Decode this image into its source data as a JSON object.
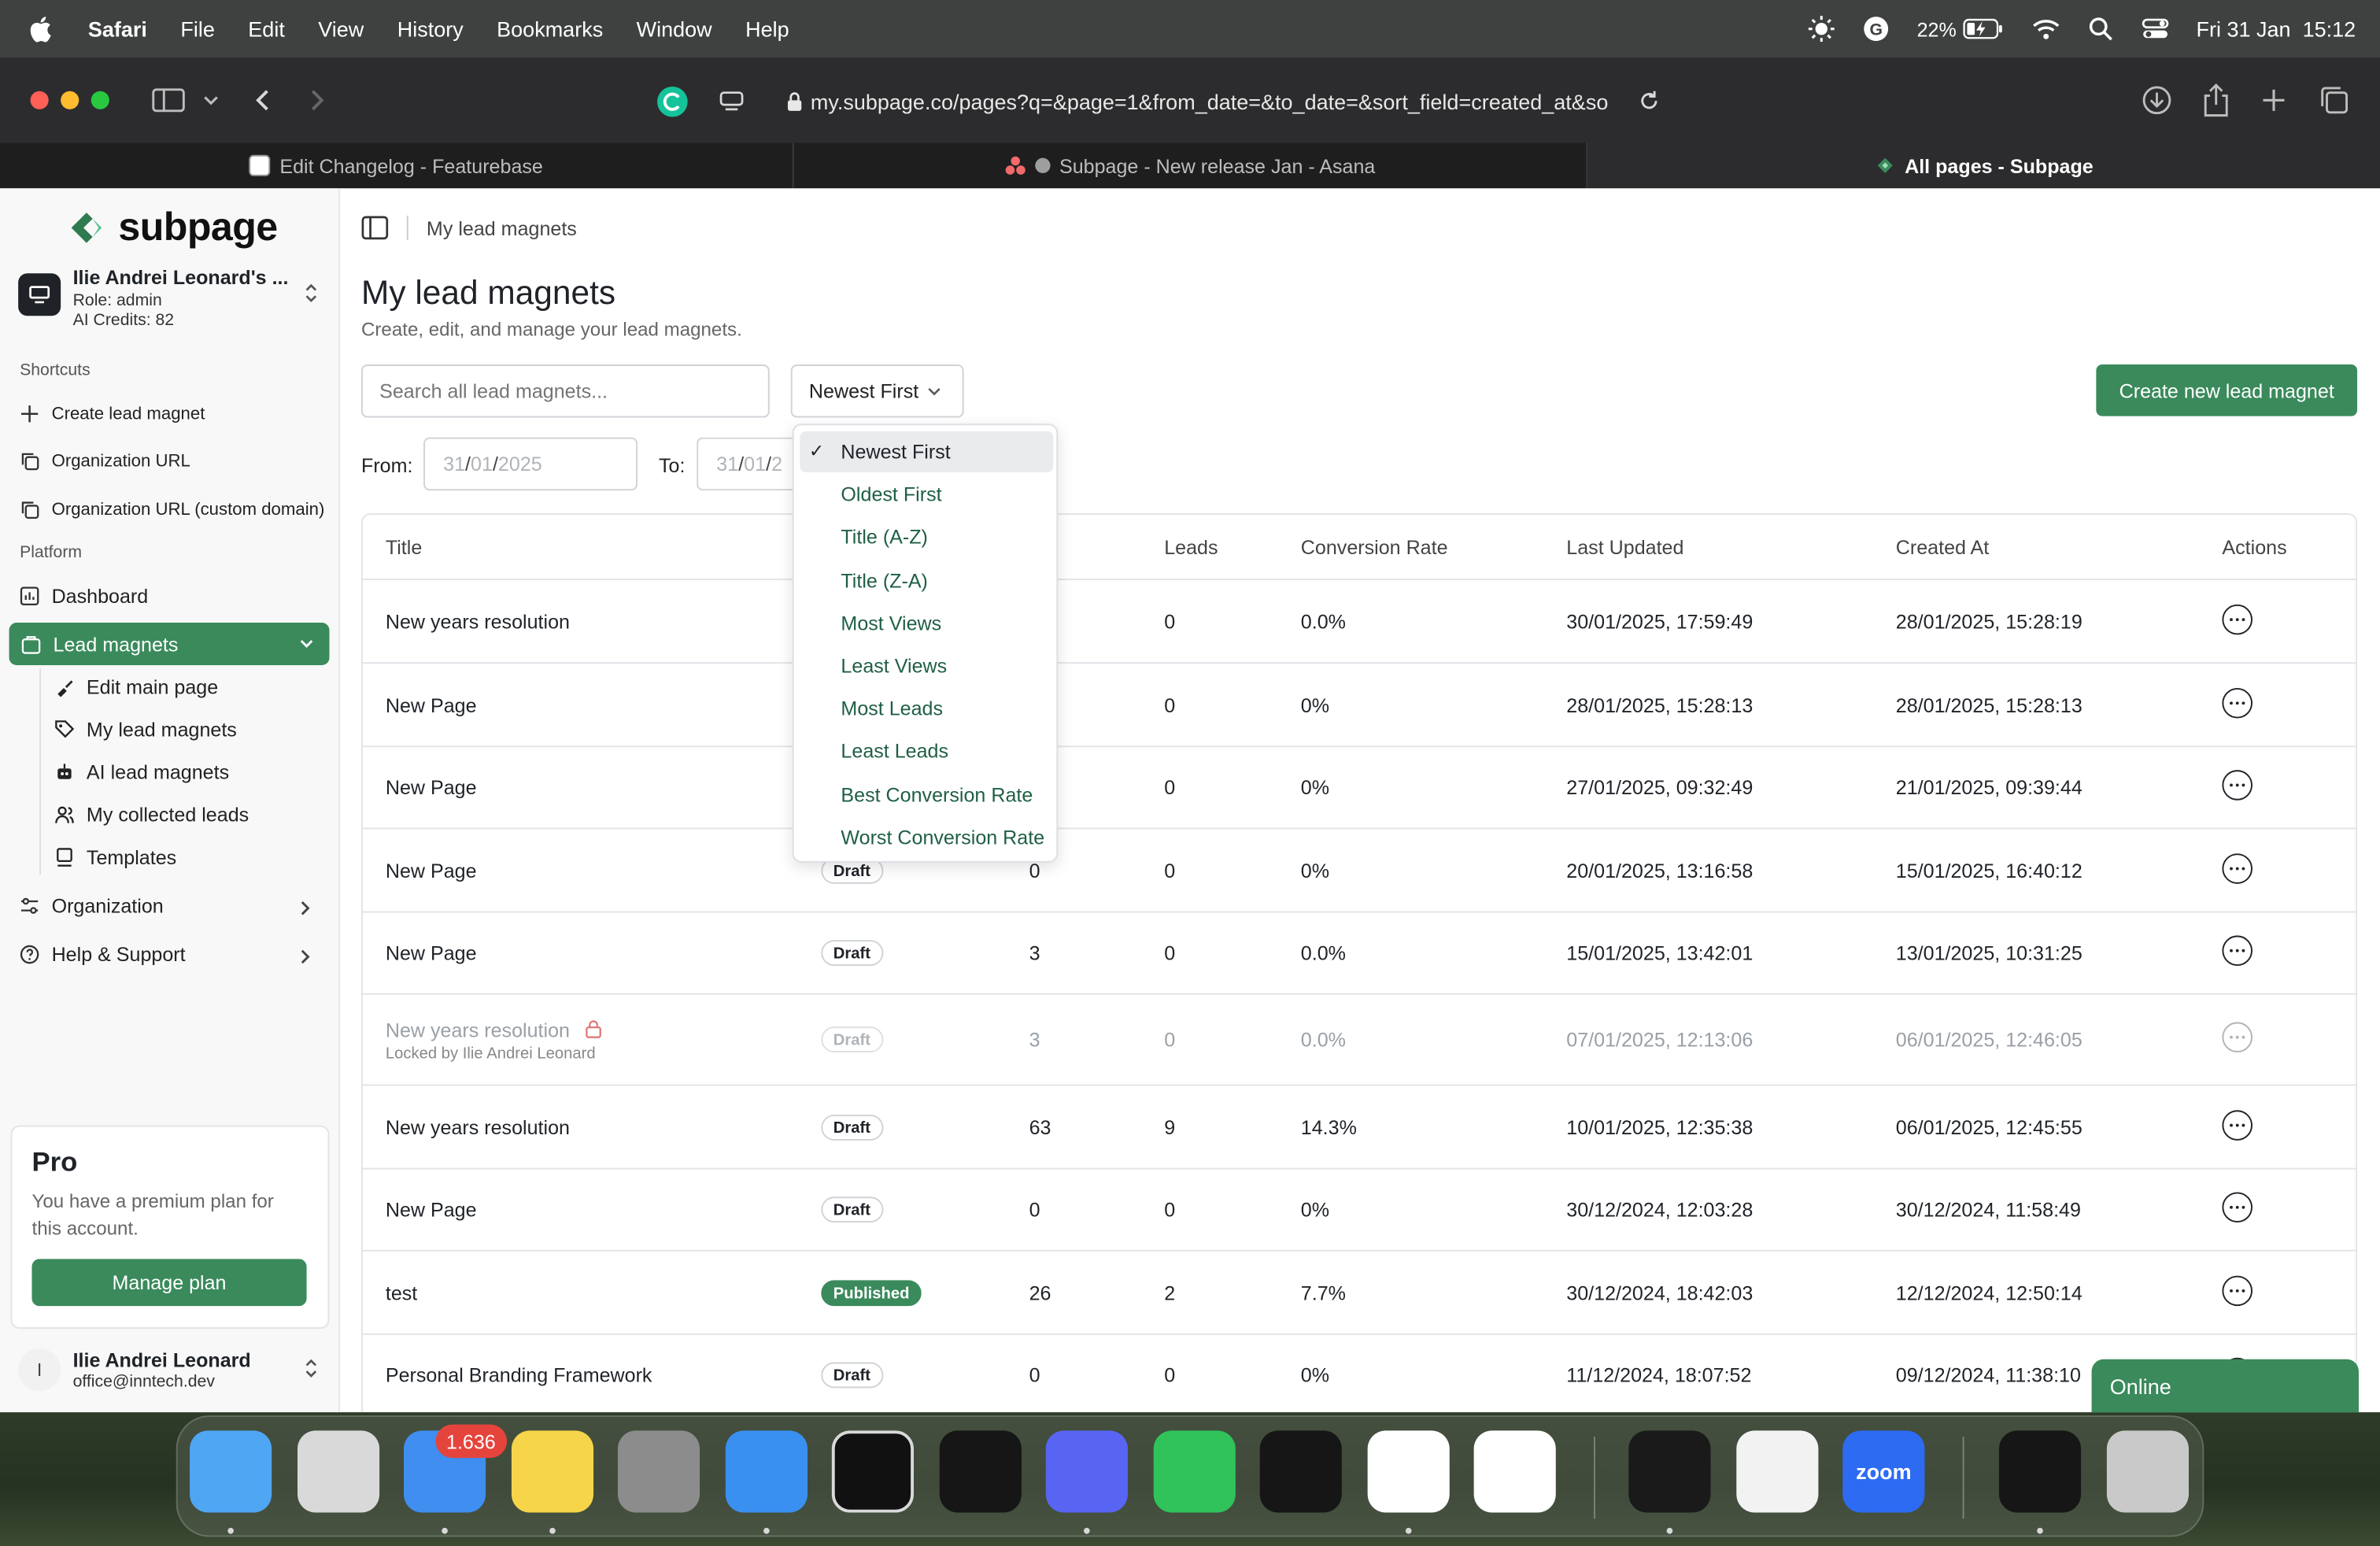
{
  "menubar": {
    "app": "Safari",
    "items": [
      "File",
      "Edit",
      "View",
      "History",
      "Bookmarks",
      "Window",
      "Help"
    ],
    "battery": "22%",
    "datetime": "Fri 31 Jan  15:12"
  },
  "browser": {
    "url": "my.subpage.co/pages?q=&page=1&from_date=&to_date=&sort_field=created_at&so",
    "tabs": [
      {
        "title": "Edit Changelog - Featurebase"
      },
      {
        "title": "Subpage - New release Jan - Asana"
      },
      {
        "title": "All pages - Subpage"
      }
    ]
  },
  "sidebar": {
    "logo": "subpage",
    "account": {
      "name": "Ilie Andrei Leonard's ...",
      "role": "Role: admin",
      "credits": "AI Credits: 82"
    },
    "shortcuts_heading": "Shortcuts",
    "shortcuts": [
      "Create lead magnet",
      "Organization URL",
      "Organization URL (custom domain)"
    ],
    "platform_heading": "Platform",
    "dashboard": "Dashboard",
    "lead_magnets": "Lead magnets",
    "sub_items": [
      "Edit main page",
      "My lead magnets",
      "AI lead magnets",
      "My collected leads",
      "Templates"
    ],
    "organization": "Organization",
    "help": "Help & Support",
    "pro": {
      "title": "Pro",
      "desc": "You have a premium plan for this account.",
      "button": "Manage plan"
    },
    "user": {
      "initial": "I",
      "name": "Ilie Andrei Leonard",
      "email": "office@inntech.dev"
    }
  },
  "main": {
    "breadcrumb": "My lead magnets",
    "title": "My lead magnets",
    "subtitle": "Create, edit, and manage your lead magnets.",
    "search_placeholder": "Search all lead magnets...",
    "sort_value": "Newest First",
    "create_button": "Create new lead magnet",
    "from_label": "From:",
    "to_label": "To:",
    "from_date": {
      "d": "31",
      "m": "01",
      "y": "2025"
    },
    "to_date": {
      "d": "31",
      "m": "01",
      "y": "2"
    },
    "columns": [
      "Title",
      "Views",
      "Leads",
      "Conversion Rate",
      "Last Updated",
      "Created At",
      "Actions"
    ],
    "visible_views_header": "ws",
    "rows": [
      {
        "title": "New years resolution",
        "status": "",
        "views": "",
        "leads": "0",
        "rate": "0.0%",
        "updated": "30/01/2025, 17:59:49",
        "created": "28/01/2025, 15:28:19"
      },
      {
        "title": "New Page",
        "status": "",
        "views": "",
        "leads": "0",
        "rate": "0%",
        "updated": "28/01/2025, 15:28:13",
        "created": "28/01/2025, 15:28:13"
      },
      {
        "title": "New Page",
        "status": "",
        "views": "",
        "leads": "0",
        "rate": "0%",
        "updated": "27/01/2025, 09:32:49",
        "created": "21/01/2025, 09:39:44"
      },
      {
        "title": "New Page",
        "status": "Draft",
        "views": "0",
        "leads": "0",
        "rate": "0%",
        "updated": "20/01/2025, 13:16:58",
        "created": "15/01/2025, 16:40:12"
      },
      {
        "title": "New Page",
        "status": "Draft",
        "views": "3",
        "leads": "0",
        "rate": "0.0%",
        "updated": "15/01/2025, 13:42:01",
        "created": "13/01/2025, 10:31:25"
      },
      {
        "title": "New years resolution",
        "status": "Draft",
        "views": "3",
        "leads": "0",
        "rate": "0.0%",
        "updated": "07/01/2025, 12:13:06",
        "created": "06/01/2025, 12:46:05",
        "locked_by": "Locked by Ilie Andrei Leonard"
      },
      {
        "title": "New years resolution",
        "status": "Draft",
        "views": "63",
        "leads": "9",
        "rate": "14.3%",
        "updated": "10/01/2025, 12:35:38",
        "created": "06/01/2025, 12:45:55"
      },
      {
        "title": "New Page",
        "status": "Draft",
        "views": "0",
        "leads": "0",
        "rate": "0%",
        "updated": "30/12/2024, 12:03:28",
        "created": "30/12/2024, 11:58:49"
      },
      {
        "title": "test",
        "status": "Published",
        "views": "26",
        "leads": "2",
        "rate": "7.7%",
        "updated": "30/12/2024, 18:42:03",
        "created": "12/12/2024, 12:50:14"
      },
      {
        "title": "Personal Branding Framework",
        "status": "Draft",
        "views": "0",
        "leads": "0",
        "rate": "0%",
        "updated": "11/12/2024, 18:07:52",
        "created": "09/12/2024, 11:38:10"
      }
    ],
    "sort_options": [
      "Newest First",
      "Oldest First",
      "Title (A-Z)",
      "Title (Z-A)",
      "Most Views",
      "Least Views",
      "Most Leads",
      "Least Leads",
      "Best Conversion Rate",
      "Worst Conversion Rate"
    ]
  },
  "chat_widget": "Online",
  "dock": {
    "mail_badge": "1.636",
    "zoom_label": "zoom"
  },
  "colors": {
    "brand_green": "#3a8a5c",
    "menubar": "#3f4141"
  }
}
